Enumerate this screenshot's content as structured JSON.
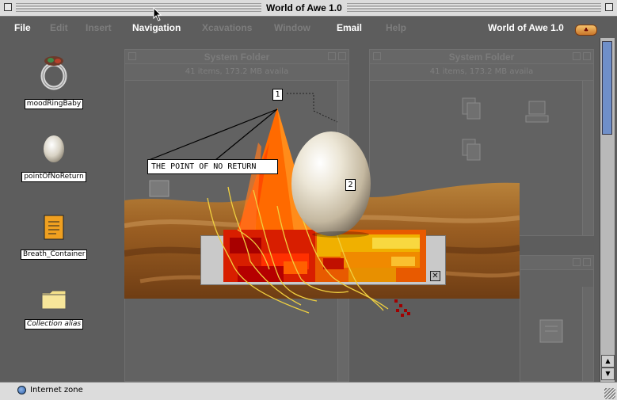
{
  "window": {
    "title": "World of Awe 1.0"
  },
  "menu": {
    "items": [
      {
        "label": "File",
        "enabled": true
      },
      {
        "label": "Edit",
        "enabled": false
      },
      {
        "label": "Insert",
        "enabled": false
      },
      {
        "label": "Navigation",
        "enabled": true
      },
      {
        "label": "Xcavations",
        "enabled": false
      },
      {
        "label": "Window",
        "enabled": false
      },
      {
        "label": "Email",
        "enabled": true
      },
      {
        "label": "Help",
        "enabled": false
      }
    ],
    "brand": "World of Awe 1.0"
  },
  "desktop_icons": [
    {
      "label": "moodRingBaby",
      "icon": "mood-ring-icon"
    },
    {
      "label": "pointOfNoReturn",
      "icon": "egg-icon"
    },
    {
      "label": "Breath_Container",
      "icon": "document-icon"
    },
    {
      "label": "Collection alias",
      "icon": "folder-alias-icon"
    }
  ],
  "finder_windows": [
    {
      "title": "System Folder",
      "info": "41 items, 173.2 MB availa"
    },
    {
      "title": "System Folder",
      "info": "41 items, 173.2 MB availa"
    }
  ],
  "artwork": {
    "caption": "THE POINT OF NO RETURN",
    "marker1": "1",
    "marker2": "2"
  },
  "statusbar": {
    "text": "Internet zone"
  },
  "colors": {
    "desktop": "#5d5d5d",
    "flame": "#ff6a00",
    "scrollthumb": "#6f8fc9"
  }
}
